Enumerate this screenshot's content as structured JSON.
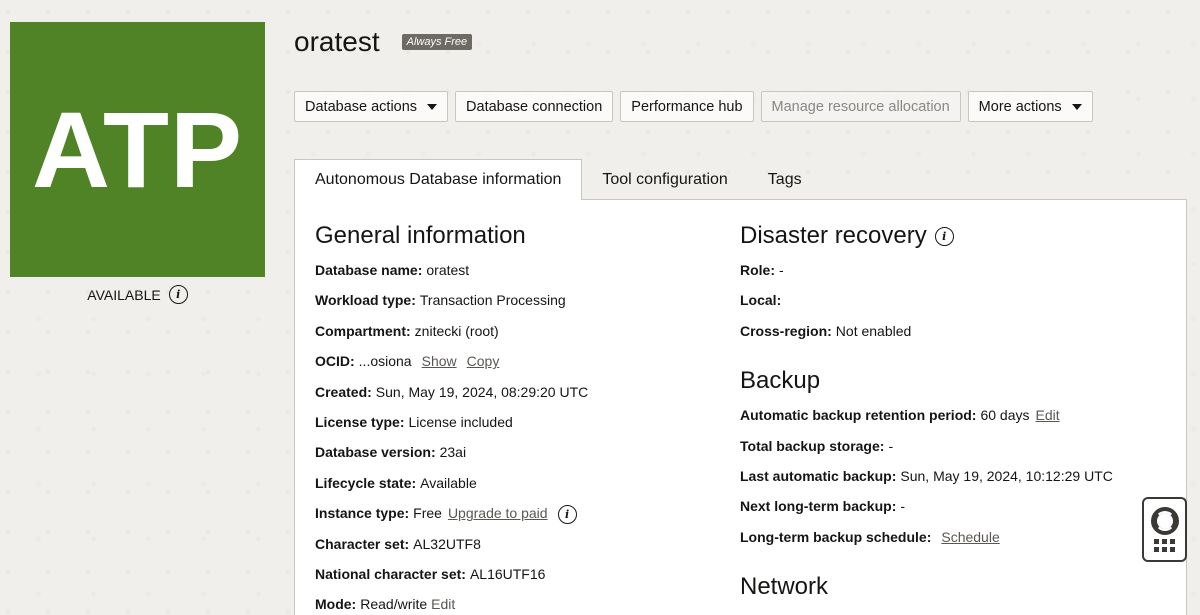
{
  "logo": {
    "text": "ATP",
    "color": "#4f8325"
  },
  "lifecycle_badge": "AVAILABLE",
  "page_title": "oratest",
  "free_badge": "Always Free",
  "actions": [
    {
      "label": "Database actions",
      "dropdown": true,
      "disabled": false
    },
    {
      "label": "Database connection",
      "dropdown": false,
      "disabled": false
    },
    {
      "label": "Performance hub",
      "dropdown": false,
      "disabled": false
    },
    {
      "label": "Manage resource allocation",
      "dropdown": false,
      "disabled": true
    },
    {
      "label": "More actions",
      "dropdown": true,
      "disabled": false
    }
  ],
  "tabs": [
    {
      "label": "Autonomous Database information",
      "active": true
    },
    {
      "label": "Tool configuration",
      "active": false
    },
    {
      "label": "Tags",
      "active": false
    }
  ],
  "general": {
    "heading": "General information",
    "db_name": {
      "label": "Database name:",
      "value": "oratest"
    },
    "workload": {
      "label": "Workload type:",
      "value": "Transaction Processing"
    },
    "compartment": {
      "label": "Compartment:",
      "value": "znitecki (root)"
    },
    "ocid": {
      "label": "OCID:",
      "value": "...osiona",
      "show": "Show",
      "copy": "Copy"
    },
    "created": {
      "label": "Created:",
      "value": "Sun, May 19, 2024, 08:29:20 UTC"
    },
    "license": {
      "label": "License type:",
      "value": "License included"
    },
    "version": {
      "label": "Database version:",
      "value": "23ai"
    },
    "lifecycle": {
      "label": "Lifecycle state:",
      "value": "Available"
    },
    "instance": {
      "label": "Instance type:",
      "value": "Free",
      "link": "Upgrade to paid"
    },
    "charset": {
      "label": "Character set:",
      "value": "AL32UTF8"
    },
    "ncharset": {
      "label": "National character set:",
      "value": "AL16UTF16"
    },
    "mode": {
      "label": "Mode:",
      "value": "Read/write",
      "link": "Edit"
    }
  },
  "dr": {
    "heading": "Disaster recovery",
    "role": {
      "label": "Role:",
      "value": "-"
    },
    "local": {
      "label": "Local:",
      "value": ""
    },
    "cross": {
      "label": "Cross-region:",
      "value": "Not enabled"
    }
  },
  "backup": {
    "heading": "Backup",
    "retention": {
      "label": "Automatic backup retention period:",
      "value": "60 days",
      "link": "Edit"
    },
    "storage": {
      "label": "Total backup storage:",
      "value": "-"
    },
    "last": {
      "label": "Last automatic backup:",
      "value": "Sun, May 19, 2024, 10:12:29 UTC"
    },
    "next": {
      "label": "Next long-term backup:",
      "value": "-"
    },
    "schedule": {
      "label": "Long-term backup schedule:",
      "link": "Schedule"
    }
  },
  "network": {
    "heading": "Network"
  }
}
